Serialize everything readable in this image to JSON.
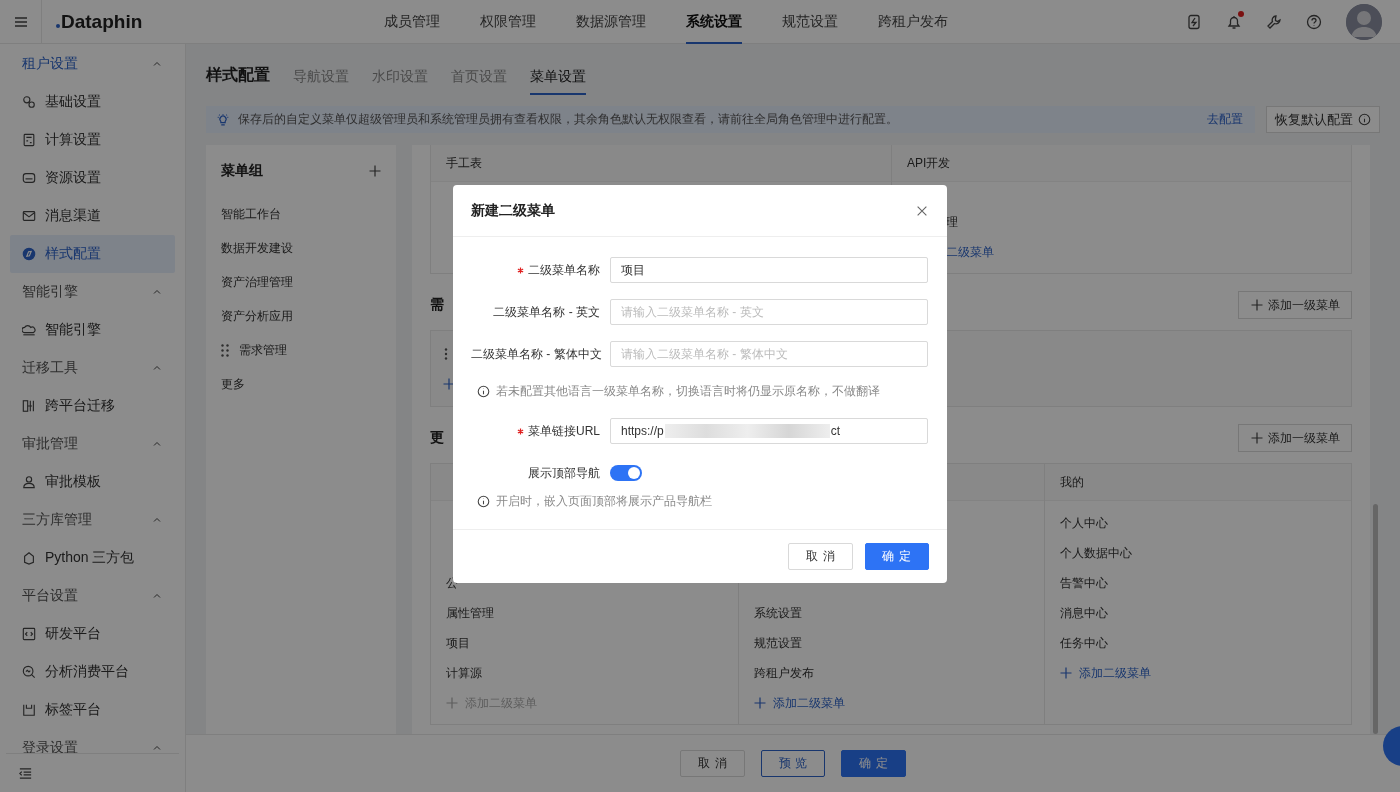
{
  "topbar": {
    "logo": "Dataphin",
    "nav": [
      {
        "label": "成员管理",
        "selected": false
      },
      {
        "label": "权限管理",
        "selected": false
      },
      {
        "label": "数据源管理",
        "selected": false
      },
      {
        "label": "系统设置",
        "selected": true
      },
      {
        "label": "规范设置",
        "selected": false
      },
      {
        "label": "跨租户发布",
        "selected": false
      }
    ],
    "has_notification": true
  },
  "sidebar": {
    "groups": [
      {
        "label": "租户设置",
        "expanded": true,
        "children": [
          {
            "label": "基础设置",
            "selected": false
          },
          {
            "label": "计算设置",
            "selected": false
          },
          {
            "label": "资源设置",
            "selected": false
          },
          {
            "label": "消息渠道",
            "selected": false
          },
          {
            "label": "样式配置",
            "selected": true
          }
        ]
      },
      {
        "label": "智能引擎",
        "expanded": true,
        "children": [
          {
            "label": "智能引擎",
            "selected": false
          }
        ]
      },
      {
        "label": "迁移工具",
        "expanded": true,
        "children": [
          {
            "label": "跨平台迁移",
            "selected": false
          }
        ]
      },
      {
        "label": "审批管理",
        "expanded": true,
        "children": [
          {
            "label": "审批模板",
            "selected": false
          }
        ]
      },
      {
        "label": "三方库管理",
        "expanded": true,
        "children": [
          {
            "label": "Python 三方包",
            "selected": false
          }
        ]
      },
      {
        "label": "平台设置",
        "expanded": true,
        "children": [
          {
            "label": "研发平台",
            "selected": false
          },
          {
            "label": "分析消费平台",
            "selected": false
          },
          {
            "label": "标签平台",
            "selected": false
          }
        ]
      },
      {
        "label": "登录设置",
        "expanded": true
      }
    ]
  },
  "page": {
    "title": "样式配置",
    "tabs": [
      {
        "label": "导航设置",
        "selected": false
      },
      {
        "label": "水印设置",
        "selected": false
      },
      {
        "label": "首页设置",
        "selected": false
      },
      {
        "label": "菜单设置",
        "selected": true
      }
    ]
  },
  "notice": {
    "text": "保存后的自定义菜单仅超级管理员和系统管理员拥有查看权限，其余角色默认无权限查看，请前往全局角色管理中进行配置。",
    "link": "去配置"
  },
  "restore_button": "恢复默认配置",
  "menu_groups": {
    "title": "菜单组",
    "items": [
      {
        "label": "智能工作台",
        "drag_handle": false
      },
      {
        "label": "数据开发建设",
        "drag_handle": false
      },
      {
        "label": "资产治理管理",
        "drag_handle": false
      },
      {
        "label": "资产分析应用",
        "drag_handle": false
      },
      {
        "label": "需求管理",
        "drag_handle": true
      },
      {
        "label": "更多",
        "drag_handle": false
      }
    ]
  },
  "top_card": {
    "columns": [
      {
        "title": "手工表"
      },
      {
        "title": "API开发",
        "items": [
          "理"
        ],
        "add_link": {
          "label": "二级菜单",
          "disabled": false
        }
      }
    ]
  },
  "sections": [
    {
      "heading": "需",
      "add_button": "添加一级菜单",
      "kind": "icons"
    },
    {
      "heading": "更",
      "add_button": "添加一级菜单",
      "kind": "columns",
      "columns": [
        {
          "items": [
            "公",
            "属性管理",
            "项目",
            "计算源"
          ],
          "add_link": {
            "label": "添加二级菜单",
            "disabled": true
          }
        },
        {
          "items": [
            "系统设置",
            "规范设置",
            "跨租户发布"
          ],
          "add_link": {
            "label": "添加二级菜单",
            "disabled": false
          }
        },
        {
          "title": "我的",
          "items": [
            "个人中心",
            "个人数据中心",
            "告警中心",
            "消息中心",
            "任务中心"
          ],
          "add_link": {
            "label": "添加二级菜单",
            "disabled": false
          }
        }
      ]
    }
  ],
  "footer_buttons": [
    {
      "label": "取消",
      "kind": "default"
    },
    {
      "label": "预览",
      "kind": "outline"
    },
    {
      "label": "确定",
      "kind": "primary"
    }
  ],
  "modal": {
    "title": "新建二级菜单",
    "rows": [
      {
        "kind": "text",
        "label": "二级菜单名称",
        "required": true,
        "value": "项目"
      },
      {
        "kind": "text",
        "label": "二级菜单名称 - 英文",
        "required": false,
        "placeholder": "请输入二级菜单名称 - 英文"
      },
      {
        "kind": "text",
        "label": "二级菜单名称 - 繁体中文",
        "required": false,
        "placeholder": "请输入二级菜单名称 - 繁体中文"
      },
      {
        "kind": "hint",
        "text": "若未配置其他语言一级菜单名称，切换语言时将仍显示原名称，不做翻译"
      },
      {
        "kind": "url",
        "label": "菜单链接URL",
        "required": true,
        "value_start": "https://p",
        "value_end": "ct"
      },
      {
        "kind": "toggle",
        "label": "展示顶部导航",
        "on": true
      },
      {
        "kind": "hint",
        "text": "开启时，嵌入页面顶部将展示产品导航栏"
      }
    ],
    "buttons": [
      {
        "label": "取消",
        "kind": "default"
      },
      {
        "label": "确定",
        "kind": "primary"
      }
    ]
  }
}
